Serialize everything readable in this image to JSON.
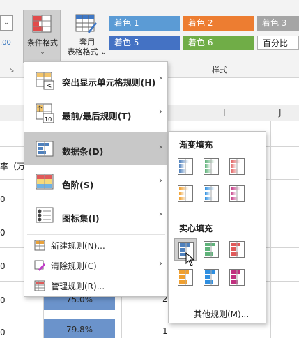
{
  "ribbon": {
    "conditional_format": {
      "label": "条件格式",
      "chevron": "⌄",
      "icon": "conditional-format-icon"
    },
    "format_as_table": {
      "label_line1": "套用",
      "label_line2": "表格格式 ⌄",
      "icon": "table-format-icon"
    },
    "styles": [
      {
        "label": "着色 1",
        "color": "#5b9bd5"
      },
      {
        "label": "着色 2",
        "color": "#ed7d31"
      },
      {
        "label": "着色 3",
        "color": "#a5a5a5"
      },
      {
        "label": "着色 5",
        "color": "#4472c4"
      },
      {
        "label": "着色 6",
        "color": "#70ad47"
      },
      {
        "label": "百分比",
        "color": "#ffffff"
      }
    ],
    "group_label": "样式",
    "left_clip": {
      "dropdown": "⌄",
      "number": ".00",
      "launcher": "↘"
    }
  },
  "sheet": {
    "columns": [
      "I",
      "J"
    ],
    "left_cells": [
      "",
      "率（万",
      "0",
      "0",
      "0",
      "0",
      "0"
    ],
    "bar_values": [
      "75.0%",
      "79.8%"
    ],
    "side_values": [
      "2",
      "1"
    ]
  },
  "menu": {
    "items": [
      {
        "label": "突出显示单元格规则(H)",
        "icon": "highlight-rules-icon"
      },
      {
        "label": "最前/最后规则(T)",
        "icon": "top-bottom-rules-icon"
      },
      {
        "label": "数据条(D)",
        "icon": "data-bars-icon"
      },
      {
        "label": "色阶(S)",
        "icon": "color-scales-icon"
      },
      {
        "label": "图标集(I)",
        "icon": "icon-sets-icon"
      }
    ],
    "small_items": [
      {
        "label": "新建规则(N)...",
        "icon": "new-rule-icon"
      },
      {
        "label": "清除规则(C)",
        "icon": "clear-rules-icon"
      },
      {
        "label": "管理规则(R)...",
        "icon": "manage-rules-icon"
      }
    ],
    "arrow": "›"
  },
  "submenu": {
    "gradient_title": "渐变填充",
    "solid_title": "实心填充",
    "colors": [
      "#4f81bd",
      "#5fb27a",
      "#e05a5a",
      "#f0a030",
      "#2f8fe0",
      "#c0307f"
    ],
    "more": "其他规则(M)..."
  }
}
